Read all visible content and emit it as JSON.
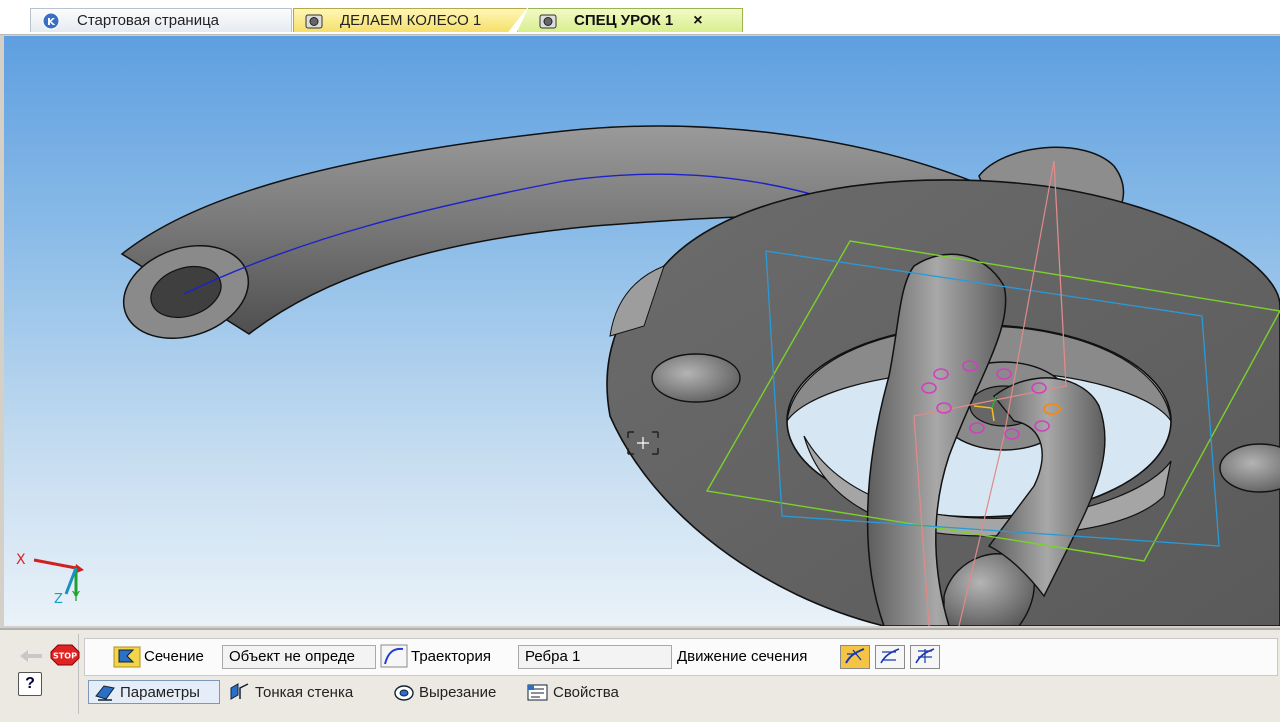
{
  "tabs": [
    {
      "label": "Стартовая страница",
      "icon": "kompas-logo-icon"
    },
    {
      "label": "ДЕЛАЕМ КОЛЕСО 1",
      "icon": "part-document-icon"
    },
    {
      "label": "СПЕЦ УРОК 1",
      "icon": "part-document-icon",
      "close": "×"
    }
  ],
  "viewport": {
    "axes": {
      "x": "X",
      "y": "Y",
      "z": "Z"
    },
    "background_top": "#5e9fe0",
    "background_bottom": "#eaf2f9"
  },
  "panel": {
    "stop_label": "STOP",
    "help_label": "?",
    "section_label": "Сечение",
    "section_value": "Объект не опреде",
    "trajectory_label": "Траектория",
    "trajectory_value": "Ребра 1",
    "movement_label": "Движение сечения",
    "movement_options": [
      "sweep-orthogonal-icon",
      "sweep-parallel-icon",
      "sweep-keep-angle-icon"
    ],
    "active_movement": 0
  },
  "param_tabs": [
    {
      "label": "Параметры",
      "icon": "parameters-icon",
      "active": true
    },
    {
      "label": "Тонкая стенка",
      "icon": "thin-wall-icon",
      "active": false
    },
    {
      "label": "Вырезание",
      "icon": "cut-icon",
      "active": false
    },
    {
      "label": "Свойства",
      "icon": "properties-icon",
      "active": false
    }
  ]
}
